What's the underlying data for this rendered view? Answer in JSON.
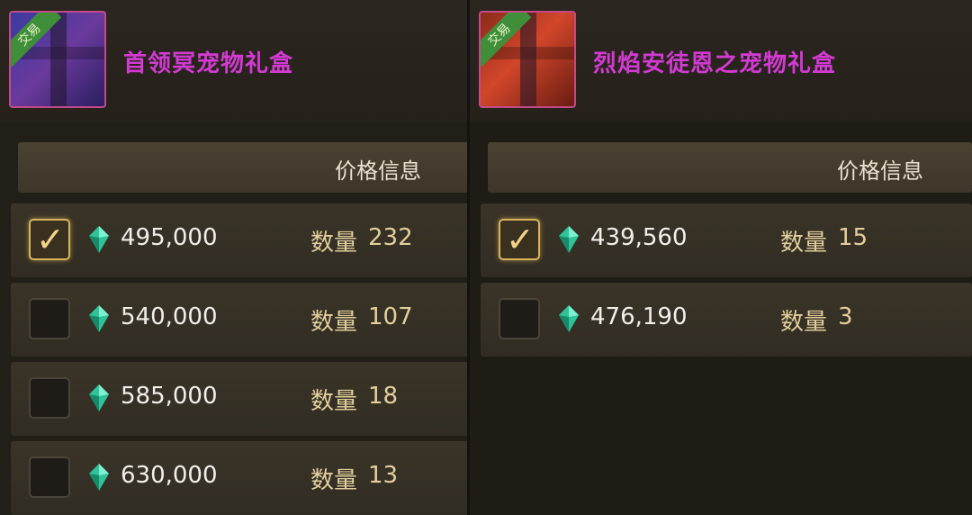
{
  "left": {
    "item_name": "首领冥宠物礼盒",
    "trade_tag": "交易",
    "column_header": "价格信息",
    "listings": [
      {
        "price": "495,000",
        "qty_label": "数量",
        "qty": "232",
        "checked": true
      },
      {
        "price": "540,000",
        "qty_label": "数量",
        "qty": "107",
        "checked": false
      },
      {
        "price": "585,000",
        "qty_label": "数量",
        "qty": "18",
        "checked": false
      },
      {
        "price": "630,000",
        "qty_label": "数量",
        "qty": "13",
        "checked": false
      }
    ]
  },
  "right": {
    "item_name": "烈焰安徒恩之宠物礼盒",
    "trade_tag": "交易",
    "column_header": "价格信息",
    "listings": [
      {
        "price": "439,560",
        "qty_label": "数量",
        "qty": "15",
        "checked": true
      },
      {
        "price": "476,190",
        "qty_label": "数量",
        "qty": "3",
        "checked": false
      }
    ]
  },
  "colors": {
    "item_name": "#d23ad2",
    "quantity": "#e2cf9c",
    "checked_border": "#d7b45c",
    "gem": "#2fc39a"
  },
  "icons": {
    "currency": "gem-icon",
    "check": "checkmark-icon",
    "tag": "trade-ribbon"
  }
}
